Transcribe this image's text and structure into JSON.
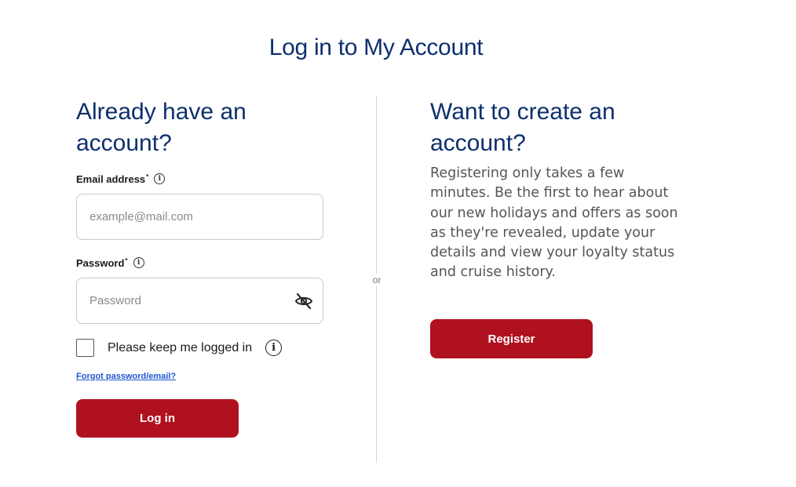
{
  "page": {
    "title": "Log in to My Account",
    "divider_text": "or"
  },
  "login": {
    "heading_line1": "Already have an",
    "heading_line2": "account?",
    "email_label": "Email address",
    "email_placeholder": "example@mail.com",
    "password_label": "Password",
    "password_placeholder": "Password",
    "required_marker": "*",
    "remember_label": "Please keep me logged in",
    "forgot_link": "Forgot password/email?",
    "login_button": "Log in",
    "icons": {
      "info": "info-icon",
      "password_visibility": "eye-slash-icon"
    }
  },
  "register": {
    "heading_line1": "Want to create an",
    "heading_line2": "account?",
    "description": "Registering only takes a few minutes. Be the first to hear about our new holidays and offers as soon as they're revealed, update your details and view your loyalty status and cruise history.",
    "register_button": "Register"
  },
  "colors": {
    "heading": "#0e2f6e",
    "primary_button": "#b0111e",
    "link": "#1f55d1"
  }
}
